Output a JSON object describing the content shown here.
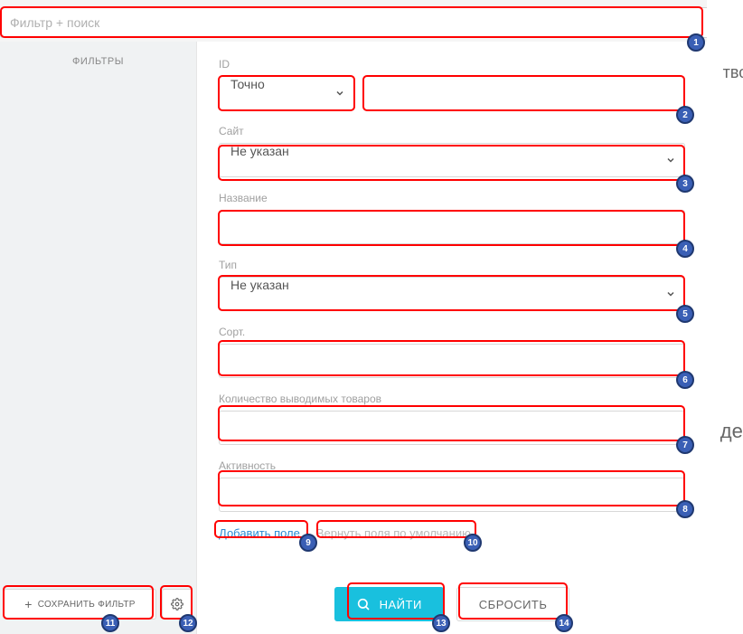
{
  "search": {
    "placeholder": "Фильтр + поиск"
  },
  "sidebar": {
    "title": "ФИЛЬТРЫ",
    "saveFilter": "СОХРАНИТЬ ФИЛЬТР"
  },
  "fields": {
    "id": {
      "label": "ID",
      "mode": "Точно",
      "value": ""
    },
    "site": {
      "label": "Сайт",
      "value": "Не указан"
    },
    "name": {
      "label": "Название",
      "value": ""
    },
    "type": {
      "label": "Тип",
      "value": "Не указан"
    },
    "sort": {
      "label": "Сорт.",
      "value": ""
    },
    "limit": {
      "label": "Количество выводимых товаров",
      "value": ""
    },
    "active": {
      "label": "Активность",
      "value": ""
    }
  },
  "links": {
    "addField": "Добавить поле",
    "resetDefault": "Вернуть поля по умолчанию"
  },
  "buttons": {
    "find": "НАЙТИ",
    "reset": "СБРОСИТЬ"
  },
  "bgHints": {
    "top": "тво по",
    "mid": "ден"
  },
  "badges": [
    "1",
    "2",
    "3",
    "4",
    "5",
    "6",
    "7",
    "8",
    "9",
    "10",
    "11",
    "12",
    "13",
    "14"
  ]
}
